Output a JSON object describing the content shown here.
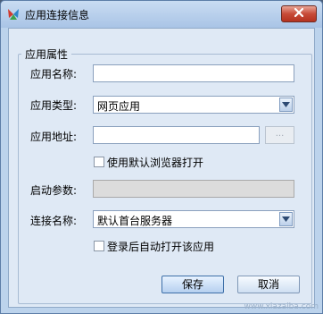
{
  "window": {
    "title": "应用连接信息"
  },
  "group": {
    "title": "应用属性"
  },
  "fields": {
    "app_name": {
      "label": "应用名称:",
      "value": ""
    },
    "app_type": {
      "label": "应用类型:",
      "value": "网页应用"
    },
    "app_address": {
      "label": "应用地址:",
      "value": "",
      "browse_label": "..."
    },
    "use_default_browser": {
      "label": "使用默认浏览器打开",
      "checked": false
    },
    "start_params": {
      "label": "启动参数:",
      "value": ""
    },
    "connection_name": {
      "label": "连接名称:",
      "value": "默认首台服务器"
    },
    "auto_open_after_login": {
      "label": "登录后自动打开该应用",
      "checked": false
    }
  },
  "buttons": {
    "save": "保存",
    "cancel": "取消"
  },
  "watermark": "www.xiazaiba.com"
}
